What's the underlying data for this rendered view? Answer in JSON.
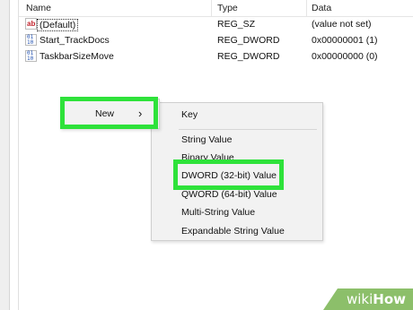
{
  "columns": {
    "name": "Name",
    "type": "Type",
    "data": "Data"
  },
  "rows": [
    {
      "name": "(Default)",
      "type": "REG_SZ",
      "data": "(value not set)",
      "icon": "string-value-icon"
    },
    {
      "name": "Start_TrackDocs",
      "type": "REG_DWORD",
      "data": "0x00000001 (1)",
      "icon": "binary-value-icon"
    },
    {
      "name": "TaskbarSizeMove",
      "type": "REG_DWORD",
      "data": "0x00000000 (0)",
      "icon": "binary-value-icon"
    }
  ],
  "context_menu": {
    "new_label": "New",
    "arrow": "›"
  },
  "submenu": {
    "items": [
      "Key",
      "String Value",
      "Binary Value",
      "DWORD (32-bit) Value",
      "QWORD (64-bit) Value",
      "Multi-String Value",
      "Expandable String Value"
    ]
  },
  "watermark": {
    "part1": "wiki",
    "part2": "How"
  },
  "colors": {
    "highlight": "#2ee23a",
    "menu_bg": "#f2f2f2",
    "watermark": "#8cbf6a"
  }
}
